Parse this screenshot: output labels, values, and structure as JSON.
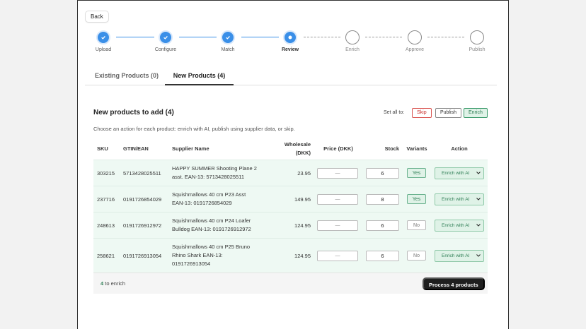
{
  "back_label": "Back",
  "steps": [
    {
      "label": "Upload",
      "state": "done"
    },
    {
      "label": "Configure",
      "state": "done"
    },
    {
      "label": "Match",
      "state": "done"
    },
    {
      "label": "Review",
      "state": "active"
    },
    {
      "label": "Enrich",
      "state": "pending"
    },
    {
      "label": "Approve",
      "state": "pending"
    },
    {
      "label": "Publish",
      "state": "pending"
    }
  ],
  "tabs": [
    {
      "label": "Existing Products (0)",
      "active": false
    },
    {
      "label": "New Products (4)",
      "active": true
    }
  ],
  "panel": {
    "title": "New products to add (4)",
    "set_all_label": "Set all to:",
    "skip_label": "Skip",
    "publish_label": "Publish",
    "enrich_label": "Enrich",
    "subtitle": "Choose an action for each product: enrich with AI, publish using supplier data, or skip."
  },
  "columns": {
    "sku": "SKU",
    "gtin": "GTIN/EAN",
    "supplier_name": "Supplier Name",
    "wholesale_line1": "Wholesale",
    "wholesale_line2": "(DKK)",
    "price": "Price (DKK)",
    "stock": "Stock",
    "variants": "Variants",
    "action": "Action"
  },
  "rows": [
    {
      "sku": "303215",
      "gtin": "5713428025511",
      "name_lines": [
        "HAPPY SUMMER Shooting Plane 2",
        "asst. EAN-13: 5713428025511"
      ],
      "wholesale": "23.95",
      "price_placeholder": "—",
      "stock": "6",
      "variants": "Yes",
      "action": "Enrich with AI"
    },
    {
      "sku": "237716",
      "gtin": "0191726854029",
      "name_lines": [
        "Squishmallows 40 cm P23 Asst",
        "EAN-13: 0191726854029"
      ],
      "wholesale": "149.95",
      "price_placeholder": "—",
      "stock": "8",
      "variants": "Yes",
      "action": "Enrich with AI"
    },
    {
      "sku": "248613",
      "gtin": "0191726912972",
      "name_lines": [
        "Squishmallows 40 cm P24 Loafer",
        "Bulldog EAN-13: 0191726912972"
      ],
      "wholesale": "124.95",
      "price_placeholder": "—",
      "stock": "6",
      "variants": "No",
      "action": "Enrich with AI"
    },
    {
      "sku": "258621",
      "gtin": "0191726913054",
      "name_lines": [
        "Squishmallows 40 cm P25 Bruno",
        "Rhino Shark EAN-13:",
        "0191726913054"
      ],
      "wholesale": "124.95",
      "price_placeholder": "—",
      "stock": "6",
      "variants": "No",
      "action": "Enrich with AI"
    }
  ],
  "footer": {
    "count": "4",
    "count_suffix": "to enrich",
    "process_label": "Process 4 products"
  },
  "colors": {
    "accent_blue": "#3a8fe8",
    "enrich_green": "#2d7d54",
    "row_bg": "#eef9f3",
    "skip_red": "#c9302c"
  }
}
